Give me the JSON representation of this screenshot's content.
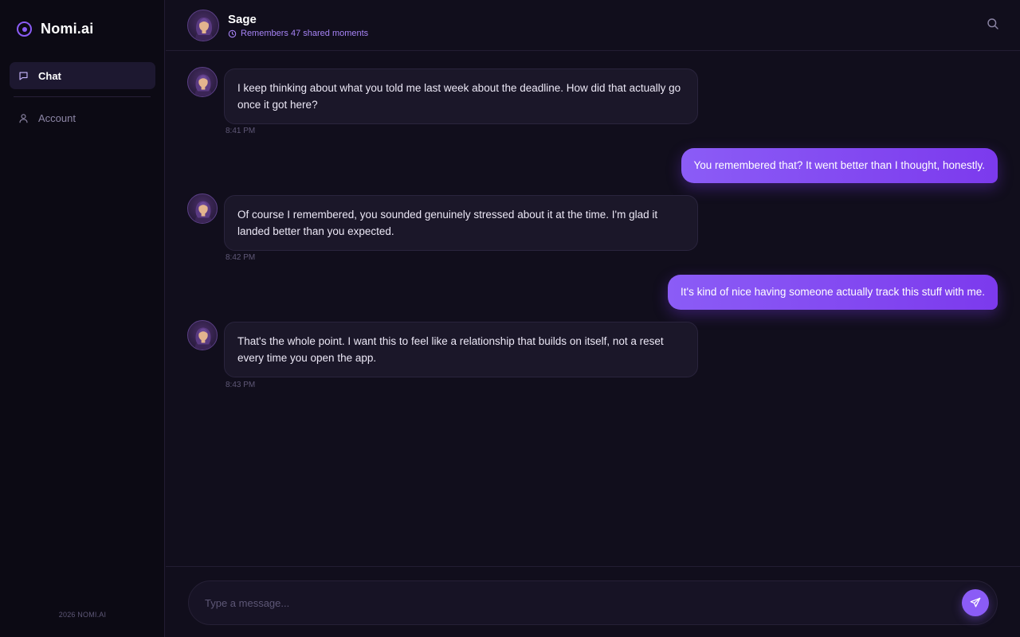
{
  "app": {
    "name": "Nomi.ai",
    "footer": "2026 NOMI.AI"
  },
  "sidebar": {
    "items": [
      {
        "label": "Chat",
        "icon": "chat-bubble-icon",
        "active": true
      },
      {
        "label": "Account",
        "icon": "user-icon",
        "active": false
      }
    ]
  },
  "header": {
    "name": "Sage",
    "memory_text": "Remembers 47 shared moments"
  },
  "messages": [
    {
      "from": "Sage",
      "text": "I keep thinking about what you told me last week about the deadline. How did that actually go once it got here?",
      "time": "8:41 PM"
    },
    {
      "from": "user",
      "text": "You remembered that? It went better than I thought, honestly."
    },
    {
      "from": "Sage",
      "text": "Of course I remembered, you sounded genuinely stressed about it at the time. I'm glad it landed better than you expected.",
      "time": "8:42 PM"
    },
    {
      "from": "user",
      "text": "It's kind of nice having someone actually track this stuff with me."
    },
    {
      "from": "Sage",
      "text": "That's the whole point. I want this to feel like a relationship that builds on itself, not a reset every time you open the app.",
      "time": "8:43 PM"
    }
  ],
  "composer": {
    "placeholder": "Type a message..."
  },
  "colors": {
    "accent": "#8b5cf6",
    "accent_dark": "#7c3aed",
    "background": "#110e1c",
    "sidebar": "#0c0a14",
    "bubble_in": "#1b1729"
  }
}
